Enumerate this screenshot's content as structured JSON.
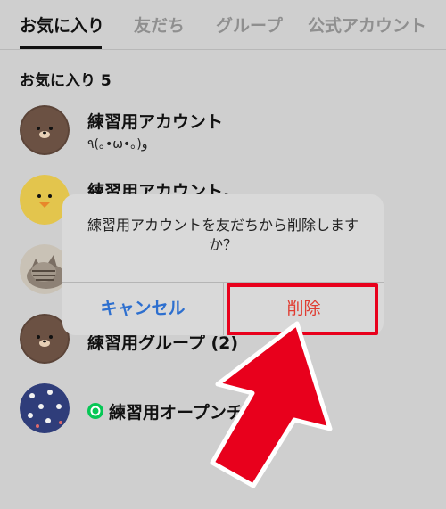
{
  "tabs": [
    "お気に入り",
    "友だち",
    "グループ",
    "公式アカウント"
  ],
  "section": {
    "title": "お気に入り 5"
  },
  "rows": [
    {
      "name": "練習用アカウント",
      "status": "٩(｡•ω•｡)و",
      "avatar": "brown-bear-icon"
    },
    {
      "name": "練習用アカウント.",
      "status": "",
      "avatar": "sally-chick-icon"
    },
    {
      "name": "",
      "status": "",
      "avatar": "cat-photo"
    },
    {
      "name": "練習用グループ (2)",
      "status": "",
      "avatar": "brown-bear-icon"
    },
    {
      "name": "練習用オープンチャット",
      "status": "",
      "avatar": "pattern-icon",
      "badge": "openchat-icon"
    }
  ],
  "dialog": {
    "message": "練習用アカウントを友だちから削除しますか？",
    "cancel_label": "キャンセル",
    "delete_label": "削除"
  },
  "colors": {
    "accent_blue": "#2d6fcf",
    "delete_red": "#e03c31",
    "highlight_red": "#e8001c",
    "openchat_green": "#06c755"
  }
}
